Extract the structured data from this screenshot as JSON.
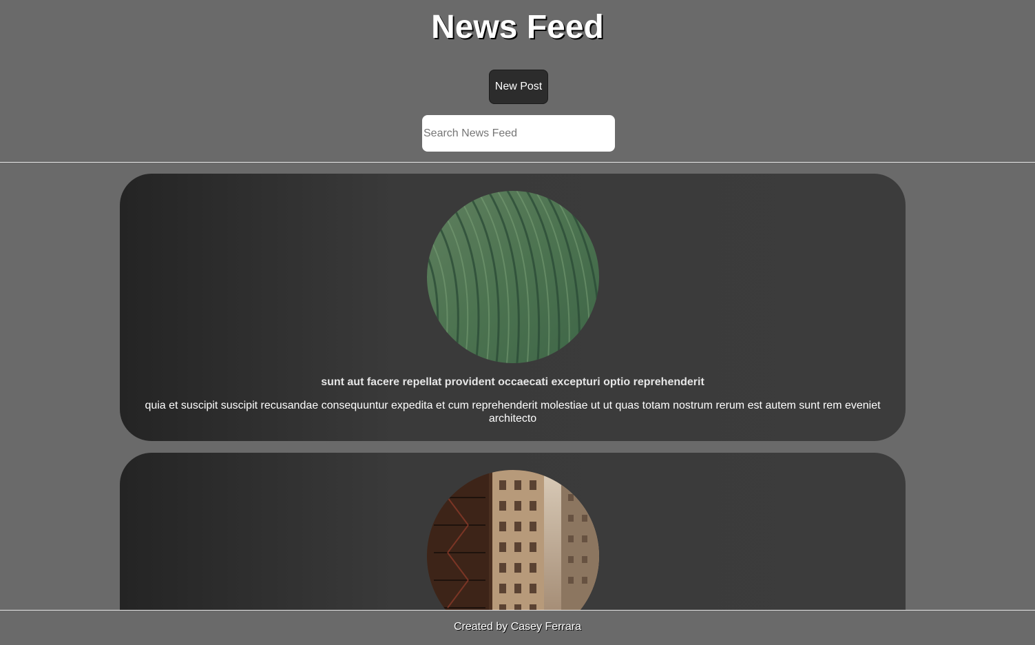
{
  "header": {
    "title": "News Feed",
    "new_post_label": "New Post",
    "search_placeholder": "Search News Feed",
    "search_value": ""
  },
  "posts": [
    {
      "title": "sunt aut facere repellat provident occaecati excepturi optio reprehenderit",
      "body": "quia et suscipit suscipit recusandae consequuntur expedita et cum reprehenderit molestiae ut ut quas totam nostrum rerum est autem sunt rem eveniet architecto",
      "image": "aerial-green-field-photo"
    },
    {
      "title": "",
      "body": "",
      "image": "city-alley-buildings-photo"
    }
  ],
  "footer": {
    "credit": "Created by Casey Ferrara"
  },
  "colors": {
    "page_background": "#6a6a6a",
    "card_background": "#3c3c3c",
    "button_background": "#2c2c2c"
  }
}
